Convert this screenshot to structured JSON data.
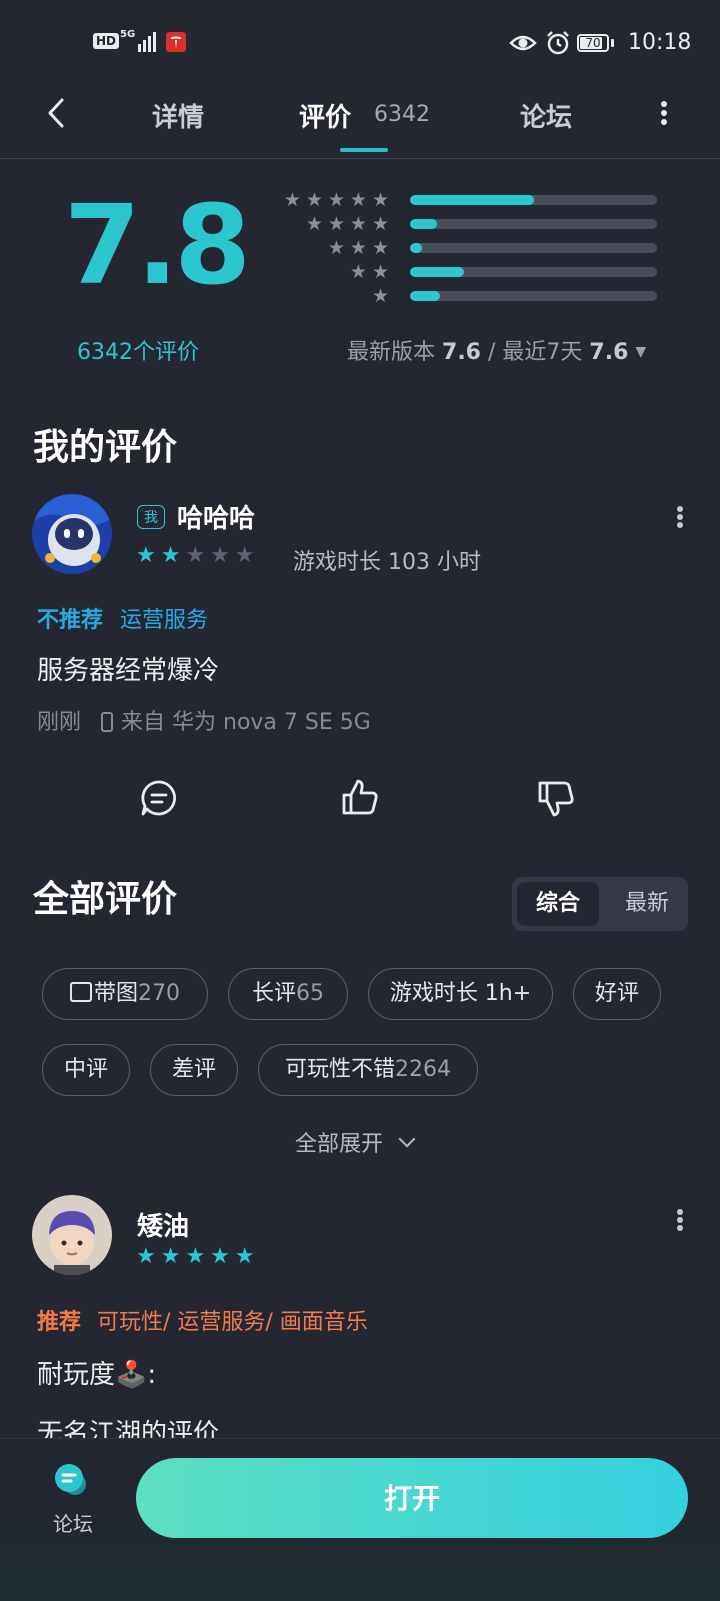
{
  "status_bar": {
    "hd": "HD",
    "network": "5G",
    "time": "10:18",
    "battery": "70"
  },
  "tabs": [
    {
      "label": "详情"
    },
    {
      "label": "评价",
      "count": "6342"
    },
    {
      "label": "论坛"
    }
  ],
  "rating": {
    "score": "7.8",
    "count_label": "6342个评价",
    "distribution": [
      {
        "stars": 5,
        "fraction": 0.5
      },
      {
        "stars": 4,
        "fraction": 0.11
      },
      {
        "stars": 3,
        "fraction": 0.05
      },
      {
        "stars": 2,
        "fraction": 0.22
      },
      {
        "stars": 1,
        "fraction": 0.12
      }
    ],
    "latest_version_label": "最新版本",
    "latest_version_score": "7.6",
    "separator": "/",
    "recent_label": "最近7天",
    "recent_score": "7.6"
  },
  "my_review": {
    "heading": "我的评价",
    "me_badge": "我",
    "username": "哈哈哈",
    "stars": 2,
    "play_time": "游戏时长 103 小时",
    "verdict": "不推荐",
    "category": "运营服务",
    "text": "服务器经常爆冷",
    "time": "刚刚",
    "device": "来自 华为 nova 7 SE 5G"
  },
  "all_reviews": {
    "heading": "全部评价",
    "sort_options": [
      "综合",
      "最新"
    ],
    "sort_selected": "综合",
    "filters": [
      {
        "label": "带图",
        "count": "270"
      },
      {
        "label": "长评",
        "count": "65"
      },
      {
        "label": "游戏时长 1h+",
        "count": ""
      },
      {
        "label": "好评",
        "count": ""
      },
      {
        "label": "中评",
        "count": ""
      },
      {
        "label": "差评",
        "count": ""
      },
      {
        "label": "可玩性不错",
        "count": "2264"
      }
    ],
    "expand_label": "全部展开"
  },
  "review_1": {
    "username": "矮油",
    "stars": 5,
    "verdict": "推荐",
    "categories": "可玩性/ 运营服务/ 画面音乐",
    "line1": "耐玩度🕹️:",
    "line2": "无名江湖的评价"
  },
  "bottom_bar": {
    "forum_label": "论坛",
    "open_button": "打开"
  },
  "colors": {
    "accent": "#2bc6ce",
    "negative_tag": "#2aa9e0",
    "positive_tag": "#f07c4a",
    "background": "#242732"
  }
}
